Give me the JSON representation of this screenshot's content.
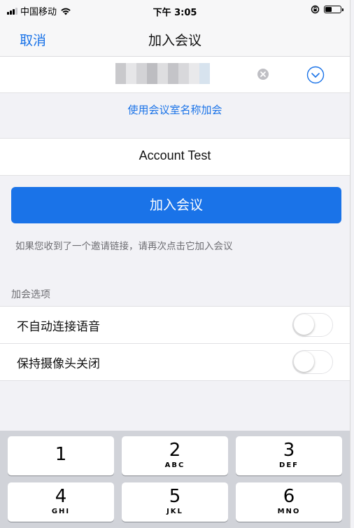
{
  "status_bar": {
    "carrier": "中国移动",
    "time": "下午 3:05",
    "battery_level": 0.45
  },
  "nav": {
    "cancel_label": "取消",
    "title": "加入会议"
  },
  "meeting_id_field": {
    "icons": {
      "clear": "clear-circle-icon",
      "history": "chevron-down-circle-icon"
    }
  },
  "room_name_link": "使用会议室名称加会",
  "name_field": {
    "value": "Account Test"
  },
  "join_button_label": "加入会议",
  "hint_text": "如果您收到了一个邀请链接，请再次点击它加入会议",
  "options": {
    "section_label": "加会选项",
    "items": [
      {
        "label": "不自动连接语音",
        "enabled": false
      },
      {
        "label": "保持摄像头关闭",
        "enabled": false
      }
    ]
  },
  "keyboard": {
    "keys": [
      {
        "digit": "1",
        "letters": ""
      },
      {
        "digit": "2",
        "letters": "ABC"
      },
      {
        "digit": "3",
        "letters": "DEF"
      },
      {
        "digit": "4",
        "letters": "GHI"
      },
      {
        "digit": "5",
        "letters": "JKL"
      },
      {
        "digit": "6",
        "letters": "MNO"
      }
    ]
  },
  "colors": {
    "accent": "#1a73e8",
    "background": "#f2f2f6",
    "keyboard": "#d1d3d9"
  }
}
